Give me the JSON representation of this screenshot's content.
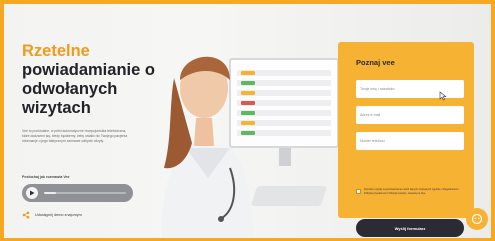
{
  "hero": {
    "headline_accent": "Rzetelne",
    "headline_rest": "powiadamianie o odwołanych wizytach",
    "description": "Vee to punktualne, w pełni automatyczne recepcjonistka telefoniczna, które dodzwoni się, kiedy będziemy, żeby ustalić nić Twojego pacjenta informacje o jego faktycznym zamiarze odbycie wizyty.",
    "listen_label": "Posłuchaj jak rozmawia Vee",
    "audio_progress": 0.15,
    "share_label": "Udostępnij demo znajomym"
  },
  "form": {
    "title": "Poznaj vee",
    "name_placeholder": "Twoje imię i nazwisko",
    "email_placeholder": "Adres e-mail",
    "phone_placeholder": "Numer telefonu",
    "consent_text": "Wyrażam zgodę na przetwarzanie moich danych osobowych zgodnie z Regulaminem. Polityka prywatności i Polityka cookies, zawartą na Vee.",
    "submit_label": "Wyślij formularz"
  },
  "colors": {
    "accent": "#f29a1c",
    "card": "#f6b233",
    "frame": "#f6a821",
    "button_dark": "#2b2b33"
  },
  "icons": {
    "play": "play-icon",
    "share": "share-icon",
    "cursor": "cursor-icon",
    "chat": "chat-widget-icon"
  }
}
